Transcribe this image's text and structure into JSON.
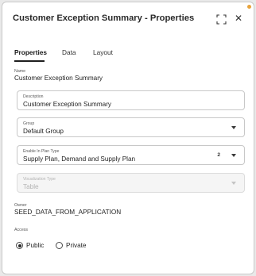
{
  "header": {
    "title": "Customer Exception Summary - Properties",
    "maximize_icon": "maximize-icon",
    "close_icon": "close-icon",
    "close_glyph": "✕"
  },
  "tabs": [
    {
      "label": "Properties",
      "active": true
    },
    {
      "label": "Data",
      "active": false
    },
    {
      "label": "Layout",
      "active": false
    }
  ],
  "name": {
    "label": "Name",
    "value": "Customer Exception Summary"
  },
  "description": {
    "label": "Description",
    "value": "Customer Exception Summary"
  },
  "group": {
    "label": "Group",
    "value": "Default Group"
  },
  "enable_in_plan_type": {
    "label": "Enable In Plan Type",
    "value": "Supply Plan, Demand and Supply Plan",
    "count": "2"
  },
  "visualization_type": {
    "label": "Visualization Type",
    "value": "Table",
    "disabled": true
  },
  "owner": {
    "label": "Owner",
    "value": "SEED_DATA_FROM_APPLICATION"
  },
  "access": {
    "label": "Access",
    "options": [
      {
        "label": "Public",
        "selected": true
      },
      {
        "label": "Private",
        "selected": false
      }
    ]
  },
  "colors": {
    "accent_dot": "#e8a33b",
    "border": "#c8c8c8",
    "text": "#1f1f1f"
  }
}
